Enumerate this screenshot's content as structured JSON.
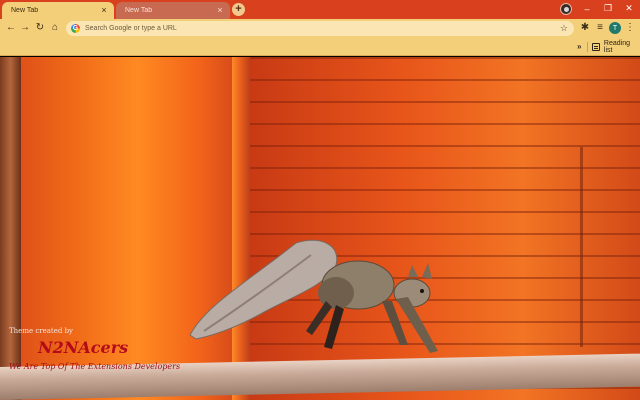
{
  "browser": {
    "tabs": [
      {
        "title": "New Tab",
        "close": "×",
        "active": true
      },
      {
        "title": "New Tab",
        "close": "×",
        "active": false
      }
    ],
    "new_tab_symbol": "+",
    "window_controls": {
      "minimize": "–",
      "maximize": "❐",
      "close": "✕"
    }
  },
  "toolbar": {
    "back": "←",
    "forward": "→",
    "reload": "↻",
    "home": "⌂",
    "google_letter": "G",
    "omnibox_placeholder": "Search Google or type a URL",
    "bookmark_star": "☆",
    "extensions": "✱",
    "media_queue": "≡",
    "avatar_letter": "T",
    "menu": "⋮"
  },
  "bookmarks_bar": {
    "overflow": "»",
    "reading_list_label": "Reading list"
  },
  "wallpaper": {
    "credit_prefix": "Theme created by",
    "brand": "N2NAcers",
    "tagline": "We Are Top Of The Extensions Developers"
  },
  "colors": {
    "frame": "#d8401e",
    "toolbar": "#f4cf7a",
    "omnibox": "#fbe6b3",
    "watermark_brand": "#b40a1a"
  }
}
